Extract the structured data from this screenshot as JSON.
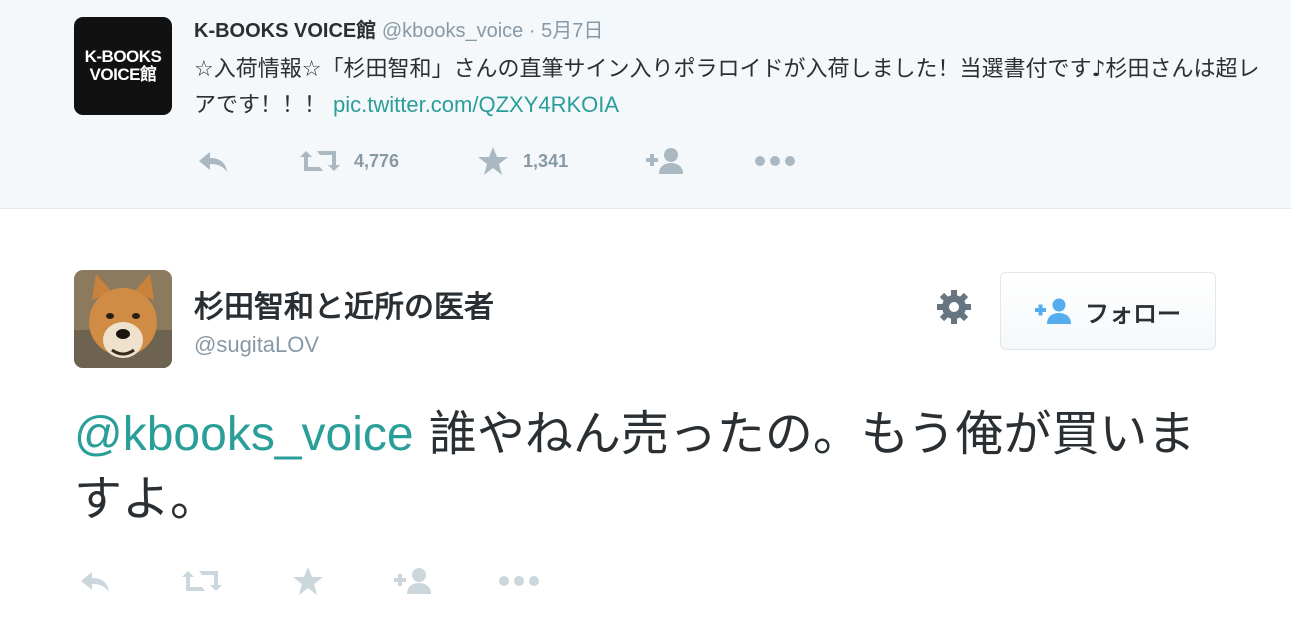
{
  "context_tweet": {
    "avatar_text": [
      "K-BOOKS",
      "VOICE館"
    ],
    "name": "K-BOOKS VOICE館",
    "handle": "@kbooks_voice",
    "separator": "·",
    "date": "5月7日",
    "text": "☆入荷情報☆「杉田智和」さんの直筆サイン入りポラロイドが入荷しました！当選書付です♪杉田さんは超レアです！！！ ",
    "link": "pic.twitter.com/QZXY4RKOIA",
    "retweet_count": "4,776",
    "favorite_count": "1,341"
  },
  "main_tweet": {
    "name": "杉田智和と近所の医者",
    "handle": "@sugitaLOV",
    "follow_label": "フォロー",
    "mention": "@kbooks_voice",
    "text": " 誰やねん売ったの。もう俺が買いますよ。"
  },
  "icons": [
    "reply-icon",
    "retweet-icon",
    "favorite-icon",
    "follow-icon",
    "more-icon",
    "gear-icon",
    "follow-plus-icon"
  ],
  "colors": {
    "link": "#2a9e99",
    "text": "#292f33",
    "muted": "#8899a6",
    "context_background": "#f5f8fa",
    "avatar_black": "#111111"
  }
}
